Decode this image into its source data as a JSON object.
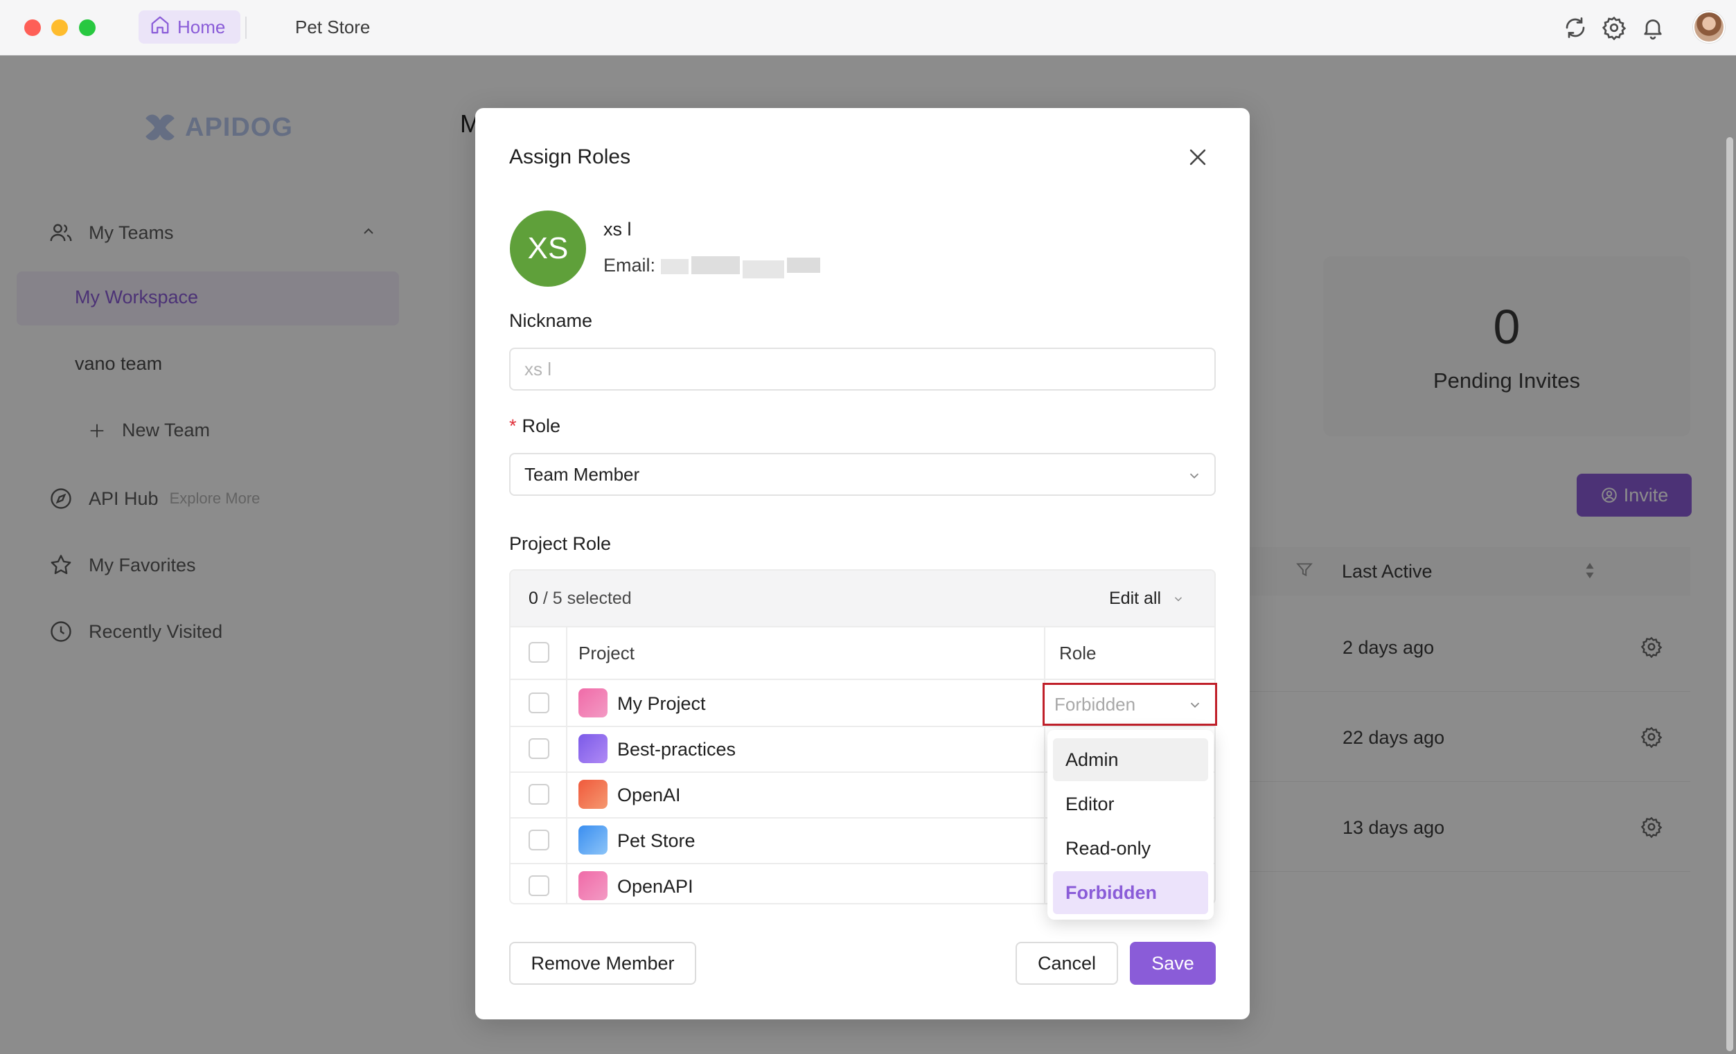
{
  "titlebar": {
    "tabs": [
      {
        "label": "Home",
        "icon": "home-icon",
        "active": true
      },
      {
        "label": "Pet Store",
        "active": false
      }
    ],
    "icons": [
      "sync-icon",
      "gear-icon",
      "bell-icon",
      "avatar"
    ]
  },
  "sidebar": {
    "logo": "APIDOG",
    "items": [
      {
        "label": "My Teams",
        "icon": "users-icon"
      },
      {
        "label": "My Workspace"
      },
      {
        "label": "vano team"
      },
      {
        "label": "New Team",
        "icon": "plus-icon"
      },
      {
        "label": "API Hub",
        "icon": "compass-icon",
        "extra": "Explore More"
      },
      {
        "label": "My Favorites",
        "icon": "star-icon"
      },
      {
        "label": "Recently Visited",
        "icon": "clock-icon"
      }
    ]
  },
  "main": {
    "title_partial": "M",
    "stat": {
      "value": "0",
      "label": "Pending Invites"
    },
    "invite_label": "Invite",
    "table_header": "Last Active",
    "rows": [
      "2 days ago",
      "22 days ago",
      "13 days ago"
    ]
  },
  "modal": {
    "title": "Assign Roles",
    "avatar_initials": "XS",
    "user_name": "xs l",
    "email_label": "Email:",
    "nickname_label": "Nickname",
    "nickname_placeholder": "xs l",
    "role_label": "Role",
    "role_value": "Team Member",
    "project_role_label": "Project Role",
    "selected_count": "0",
    "selected_total": "/ 5 selected",
    "edit_all": "Edit all",
    "col_project": "Project",
    "col_role": "Role",
    "projects": [
      {
        "name": "My Project",
        "icon": "book-icon"
      },
      {
        "name": "Best-practices",
        "icon": "rocket-icon"
      },
      {
        "name": "OpenAI",
        "icon": "calendar-icon"
      },
      {
        "name": "Pet Store",
        "icon": "bird-icon"
      },
      {
        "name": "OpenAPI",
        "icon": "book-icon"
      }
    ],
    "selected_role_value": "Forbidden",
    "role_options": [
      "Admin",
      "Editor",
      "Read-only",
      "Forbidden"
    ],
    "remove_label": "Remove Member",
    "cancel_label": "Cancel",
    "save_label": "Save"
  },
  "colors": {
    "accent": "#8a5cd8",
    "avatar_bg": "#5fa03a",
    "highlight_border": "#c0202a"
  }
}
